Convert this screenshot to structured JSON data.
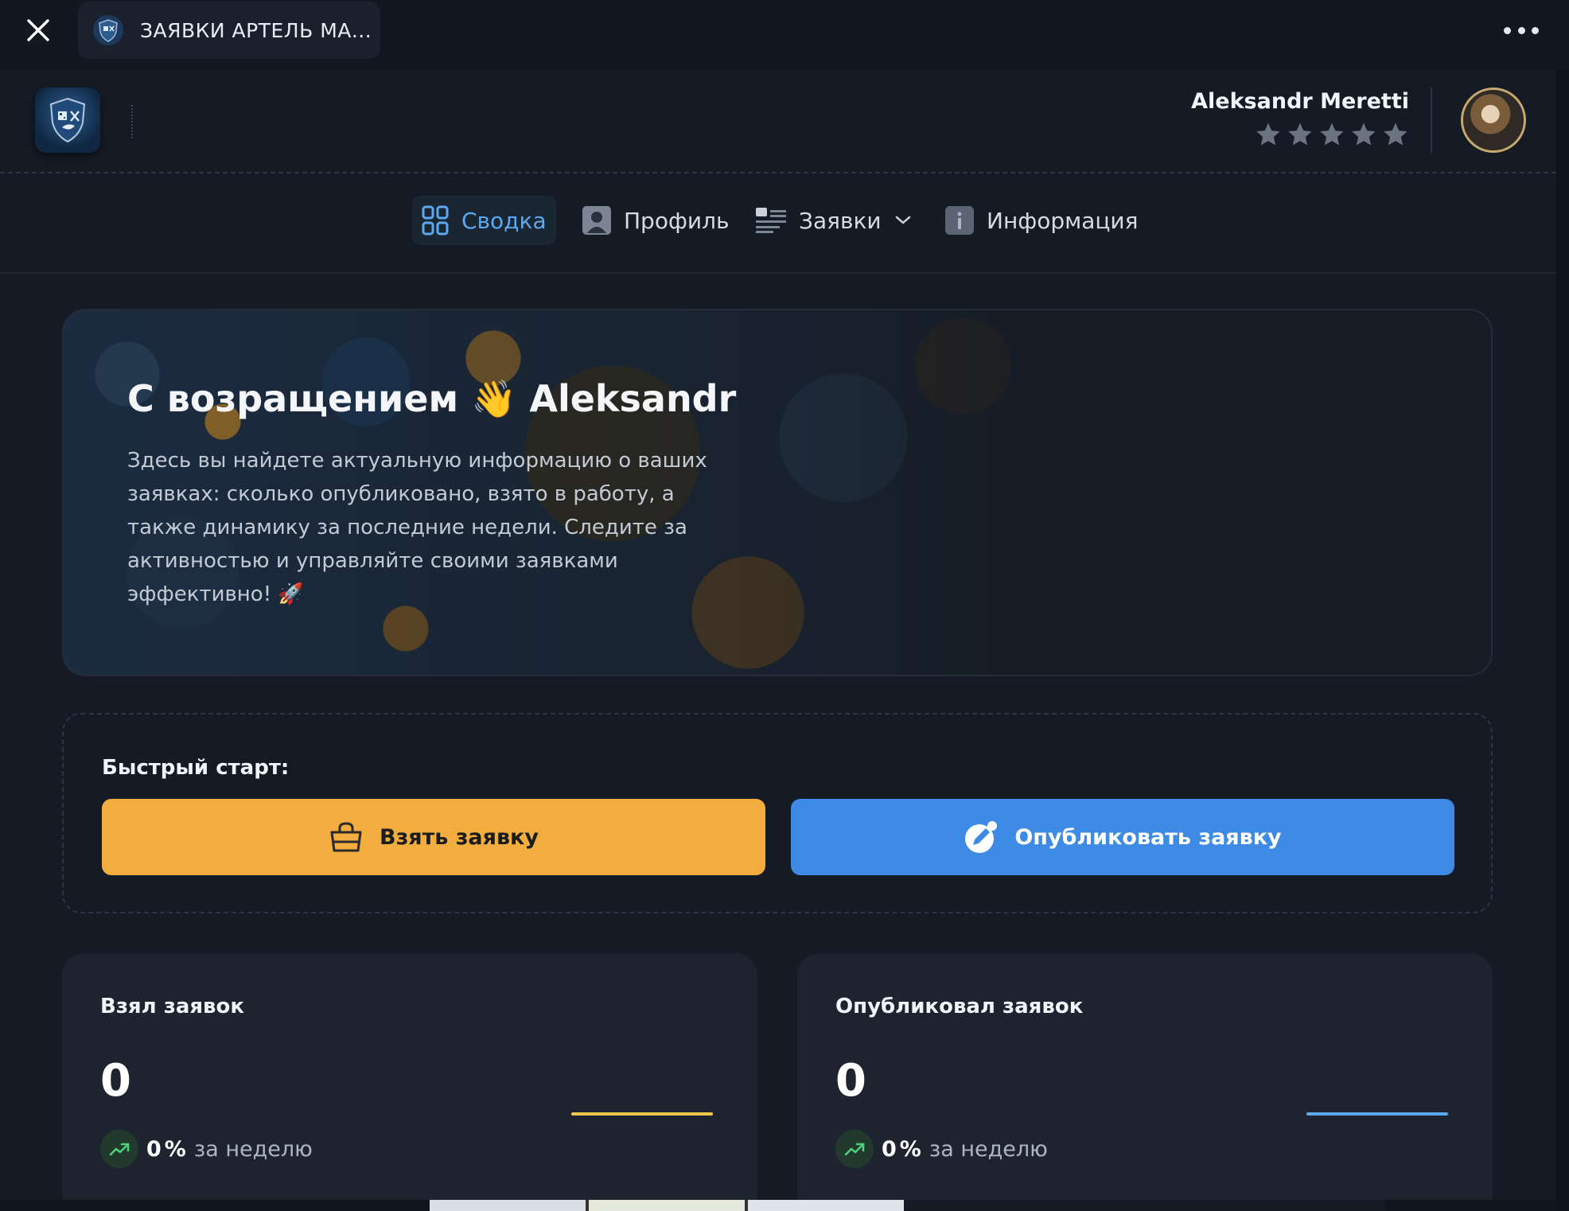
{
  "window": {
    "tab_title": "ЗАЯВКИ АРТЕЛЬ МА..."
  },
  "header": {
    "user_name": "Aleksandr Meretti",
    "rating_stars": 0,
    "rating_max": 5
  },
  "nav": {
    "items": [
      {
        "label": "Сводка",
        "icon": "grid-icon",
        "active": true
      },
      {
        "label": "Профиль",
        "icon": "user-icon",
        "active": false
      },
      {
        "label": "Заявки",
        "icon": "list-icon",
        "active": false,
        "has_dropdown": true
      },
      {
        "label": "Информация",
        "icon": "info-icon",
        "active": false
      }
    ]
  },
  "hero": {
    "title_prefix": "С возращением",
    "wave_emoji": "👋",
    "title_name": "Aleksandr",
    "text": "Здесь вы найдете актуальную информацию о ваших заявках: сколько опубликовано, взято в работу, а также динамику за последние недели. Следите за активностью и управляйте своими заявками эффективно! 🚀"
  },
  "quick_start": {
    "title": "Быстрый старт:",
    "take_label": "Взять заявку",
    "publish_label": "Опубликовать заявку"
  },
  "stats": [
    {
      "title": "Взял заявок",
      "value": "0",
      "trend_value": "0",
      "trend_unit": "%",
      "trend_text": "за неделю",
      "spark_color": "#f2c94c"
    },
    {
      "title": "Опубликовал заявок",
      "value": "0",
      "trend_value": "0",
      "trend_unit": "%",
      "trend_text": "за неделю",
      "spark_color": "#5aa9f2"
    }
  ],
  "colors": {
    "accent": "#5aa9f2",
    "take_button": "#f2ad3e",
    "publish_button": "#3d8be5",
    "trend_green": "#4cd17a"
  }
}
